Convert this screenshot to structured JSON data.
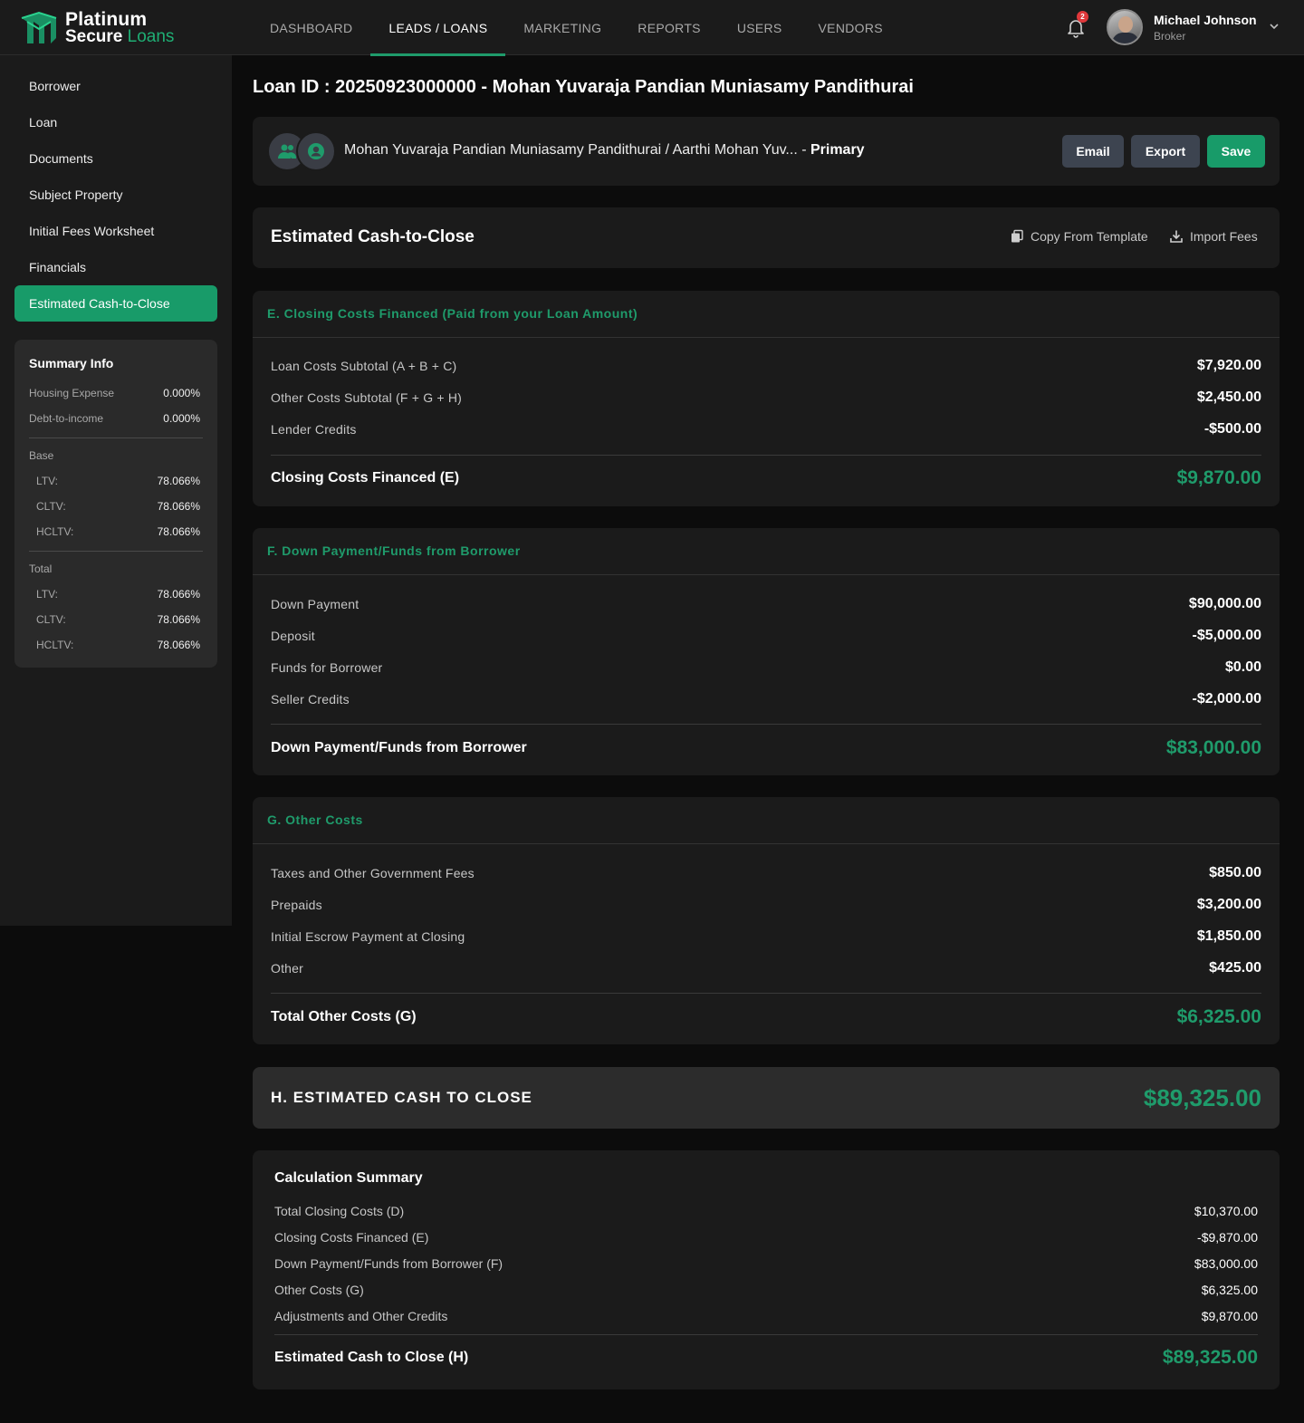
{
  "brand": {
    "line1": "Platinum",
    "line2a": "Secure",
    "line2b": "Loans",
    "accent": "#1fae74"
  },
  "nav": {
    "items": [
      "DASHBOARD",
      "LEADS / LOANS",
      "MARKETING",
      "REPORTS",
      "USERS",
      "VENDORS"
    ],
    "active": "LEADS / LOANS"
  },
  "notifications": {
    "count": "2"
  },
  "user": {
    "name": "Michael Johnson",
    "role": "Broker"
  },
  "sidebar": {
    "items": [
      "Borrower",
      "Loan",
      "Documents",
      "Subject Property",
      "Initial Fees Worksheet",
      "Financials",
      "Estimated Cash-to-Close"
    ],
    "active": "Estimated Cash-to-Close"
  },
  "summary": {
    "title": "Summary Info",
    "housing_label": "Housing Expense",
    "housing_value": "0.000%",
    "dti_label": "Debt-to-income",
    "dti_value": "0.000%",
    "base_label": "Base",
    "base": [
      {
        "k": "LTV:",
        "v": "78.066%"
      },
      {
        "k": "CLTV:",
        "v": "78.066%"
      },
      {
        "k": "HCLTV:",
        "v": "78.066%"
      }
    ],
    "total_label": "Total",
    "total": [
      {
        "k": "LTV:",
        "v": "78.066%"
      },
      {
        "k": "CLTV:",
        "v": "78.066%"
      },
      {
        "k": "HCLTV:",
        "v": "78.066%"
      }
    ]
  },
  "page": {
    "title": "Loan ID : 20250923000000 - Mohan Yuvaraja Pandian Muniasamy Pandithurai",
    "borrowers": "Mohan Yuvaraja Pandian Muniasamy Pandithurai / Aarthi Mohan Yuv... - ",
    "borrower_tag": "Primary",
    "email_label": "Email",
    "export_label": "Export",
    "save_label": "Save"
  },
  "ectc": {
    "title": "Estimated Cash-to-Close",
    "copy_label": "Copy From Template",
    "import_label": "Import Fees"
  },
  "section_e": {
    "heading": "E. Closing Costs Financed (Paid from your Loan Amount)",
    "rows": [
      {
        "label": "Loan Costs Subtotal (A + B + C)",
        "amount": "$7,920.00"
      },
      {
        "label": "Other Costs Subtotal (F + G + H)",
        "amount": "$2,450.00"
      },
      {
        "label": "Lender Credits",
        "amount": "-$500.00"
      }
    ],
    "total_label": "Closing Costs Financed (E)",
    "total_amount": "$9,870.00"
  },
  "section_f": {
    "heading": "F. Down Payment/Funds from Borrower",
    "rows": [
      {
        "label": "Down Payment",
        "amount": "$90,000.00"
      },
      {
        "label": "Deposit",
        "amount": "-$5,000.00"
      },
      {
        "label": "Funds for Borrower",
        "amount": "$0.00"
      },
      {
        "label": "Seller Credits",
        "amount": "-$2,000.00"
      }
    ],
    "total_label": "Down Payment/Funds from Borrower",
    "total_amount": "$83,000.00"
  },
  "section_g": {
    "heading": "G. Other Costs",
    "rows": [
      {
        "label": "Taxes and Other Government Fees",
        "amount": "$850.00"
      },
      {
        "label": "Prepaids",
        "amount": "$3,200.00"
      },
      {
        "label": "Initial Escrow Payment at Closing",
        "amount": "$1,850.00"
      },
      {
        "label": "Other",
        "amount": "$425.00"
      }
    ],
    "total_label": "Total Other Costs (G)",
    "total_amount": "$6,325.00"
  },
  "section_h": {
    "label": "H. ESTIMATED CASH TO CLOSE",
    "amount": "$89,325.00"
  },
  "calc": {
    "title": "Calculation Summary",
    "rows": [
      {
        "label": "Total Closing Costs (D)",
        "amount": "$10,370.00"
      },
      {
        "label": "Closing Costs Financed (E)",
        "amount": "-$9,870.00"
      },
      {
        "label": "Down Payment/Funds from Borrower (F)",
        "amount": "$83,000.00"
      },
      {
        "label": "Other Costs (G)",
        "amount": "$6,325.00"
      },
      {
        "label": "Adjustments and Other Credits",
        "amount": "$9,870.00"
      }
    ],
    "total_label": "Estimated Cash to Close (H)",
    "total_amount": "$89,325.00"
  }
}
